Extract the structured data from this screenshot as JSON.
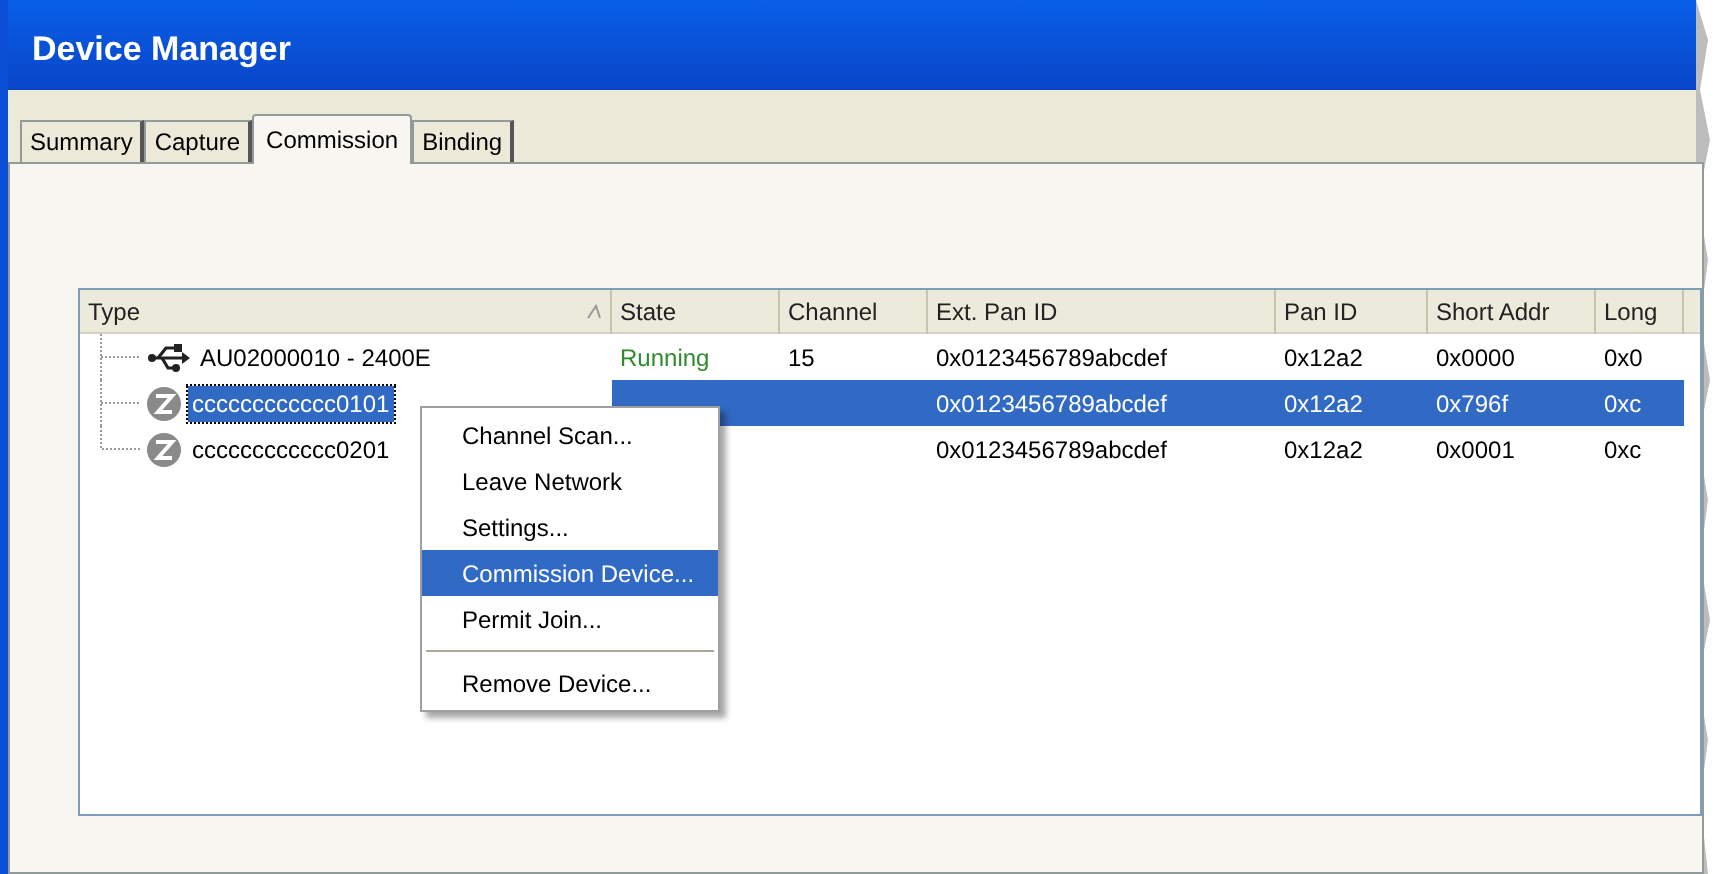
{
  "window": {
    "title": "Device Manager"
  },
  "tabs": [
    {
      "label": "Summary",
      "selected": false
    },
    {
      "label": "Capture",
      "selected": false
    },
    {
      "label": "Commission",
      "selected": true
    },
    {
      "label": "Binding",
      "selected": false
    }
  ],
  "table": {
    "columns": [
      "Type",
      "State",
      "Channel",
      "Ext. Pan ID",
      "Pan ID",
      "Short Addr",
      "Long"
    ],
    "rows": [
      {
        "kind": "usb",
        "selected": false,
        "cells": [
          "AU02000010 - 2400E",
          "Running",
          "15",
          "0x0123456789abcdef",
          "0x12a2",
          "0x0000",
          "0x0"
        ]
      },
      {
        "kind": "zigbee",
        "selected": true,
        "cells": [
          "cccccccccccc0101",
          null,
          null,
          "0x0123456789abcdef",
          "0x12a2",
          "0x796f",
          "0xc"
        ]
      },
      {
        "kind": "zigbee",
        "selected": false,
        "cells": [
          "cccccccccccc0201",
          null,
          null,
          "0x0123456789abcdef",
          "0x12a2",
          "0x0001",
          "0xc"
        ]
      }
    ]
  },
  "context_menu": {
    "items": [
      {
        "kind": "item",
        "label": "Channel Scan...",
        "selected": false
      },
      {
        "kind": "item",
        "label": "Leave Network",
        "selected": false
      },
      {
        "kind": "item",
        "label": "Settings...",
        "selected": false
      },
      {
        "kind": "item",
        "label": "Commission Device...",
        "selected": true
      },
      {
        "kind": "item",
        "label": "Permit Join...",
        "selected": false
      },
      {
        "kind": "separator"
      },
      {
        "kind": "item",
        "label": "Remove Device...",
        "selected": false
      }
    ]
  }
}
